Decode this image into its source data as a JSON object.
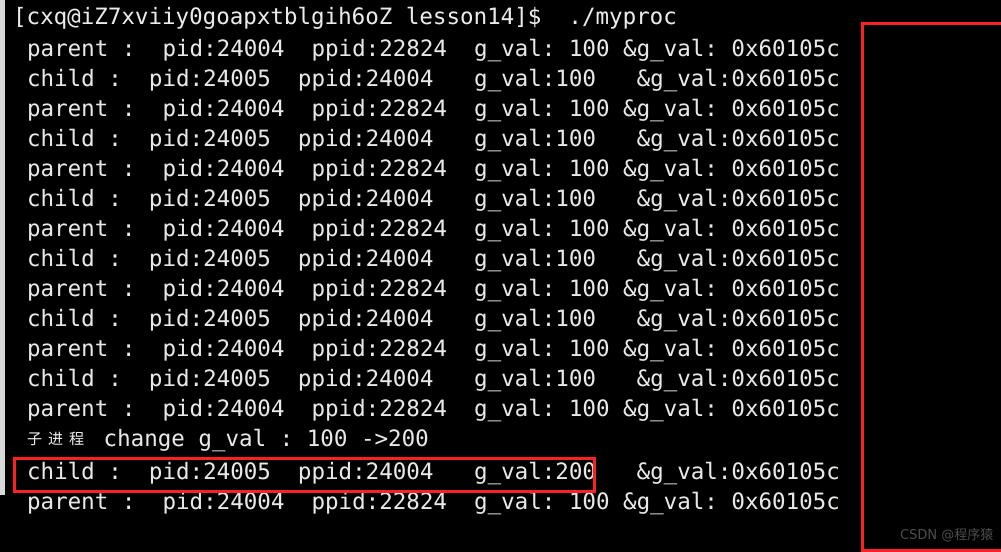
{
  "terminal": {
    "prompt": "[cxq@iZ7xviiy0goapxtblgih6oZ lesson14]$  ./myproc",
    "user": "cxq",
    "host": "iZ7xviiy0goapxtblgih6oZ",
    "cwd": "lesson14",
    "command": "./myproc",
    "background_color": "#000000",
    "foreground_color": "#e8e8e8",
    "annotation_color": "#fc1f23",
    "lines": [
      {
        "type": "parent",
        "text": "parent :  pid:24004  ppid:22824  g_val: 100 &g_val: 0x60105c"
      },
      {
        "type": "child",
        "text": "child :  pid:24005  ppid:24004   g_val:100   &g_val:0x60105c"
      },
      {
        "type": "parent",
        "text": "parent :  pid:24004  ppid:22824  g_val: 100 &g_val: 0x60105c"
      },
      {
        "type": "child",
        "text": "child :  pid:24005  ppid:24004   g_val:100   &g_val:0x60105c"
      },
      {
        "type": "parent",
        "text": "parent :  pid:24004  ppid:22824  g_val: 100 &g_val: 0x60105c"
      },
      {
        "type": "child",
        "text": "child :  pid:24005  ppid:24004   g_val:100   &g_val:0x60105c"
      },
      {
        "type": "parent",
        "text": "parent :  pid:24004  ppid:22824  g_val: 100 &g_val: 0x60105c"
      },
      {
        "type": "child",
        "text": "child :  pid:24005  ppid:24004   g_val:100   &g_val:0x60105c"
      },
      {
        "type": "parent",
        "text": "parent :  pid:24004  ppid:22824  g_val: 100 &g_val: 0x60105c"
      },
      {
        "type": "child",
        "text": "child :  pid:24005  ppid:24004   g_val:100   &g_val:0x60105c"
      },
      {
        "type": "parent",
        "text": "parent :  pid:24004  ppid:22824  g_val: 100 &g_val: 0x60105c"
      },
      {
        "type": "child",
        "text": "child :  pid:24005  ppid:24004   g_val:100   &g_val:0x60105c"
      },
      {
        "type": "parent",
        "text": "parent :  pid:24004  ppid:22824  g_val: 100 &g_val: 0x60105c"
      },
      {
        "type": "change_cn",
        "cn": "子进程",
        "text": " change g_val : 100 ->200"
      },
      {
        "type": "child",
        "text": "child :  pid:24005  ppid:24004   g_val:200   &g_val:0x60105c"
      },
      {
        "type": "parent",
        "text": "parent :  pid:24004  ppid:22824  g_val: 100 &g_val: 0x60105c"
      }
    ]
  },
  "annotations": {
    "address_box_label": "0x60105c",
    "change_box_label": "子进程 change g_val : 100 ->200"
  },
  "watermark": {
    "text": "CSDN @程序猿"
  }
}
